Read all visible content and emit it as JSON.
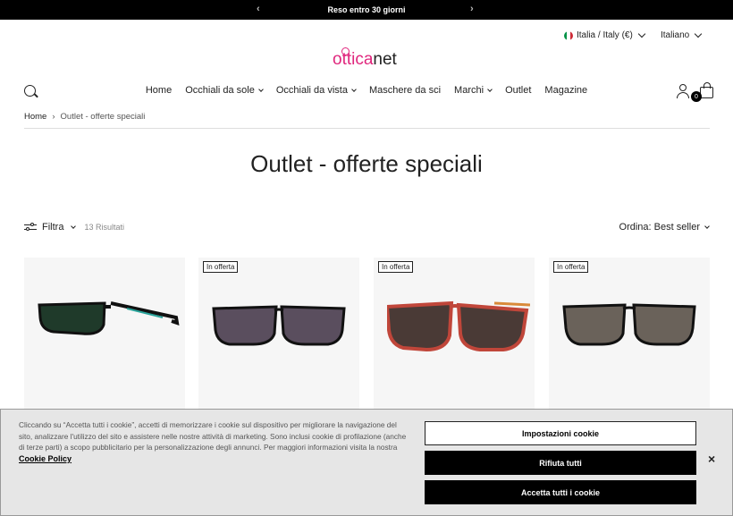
{
  "announcement": {
    "text": "Reso entro 30 giorni",
    "prev_icon": "chevron-left-icon",
    "next_icon": "chevron-right-icon"
  },
  "header": {
    "country": "Italia / Italy (€)",
    "language": "Italiano",
    "logo_part1": "ottica",
    "logo_part2": "net",
    "cart_count": "0"
  },
  "nav": {
    "items": [
      {
        "label": "Home"
      },
      {
        "label": "Occhiali da sole"
      },
      {
        "label": "Occhiali da vista"
      },
      {
        "label": "Maschere da sci"
      },
      {
        "label": "Marchi"
      },
      {
        "label": "Outlet"
      },
      {
        "label": "Magazine"
      }
    ]
  },
  "breadcrumb": {
    "home": "Home",
    "separator": "›",
    "current": "Outlet - offerte speciali"
  },
  "page": {
    "title": "Outlet - offerte speciali"
  },
  "toolbar": {
    "filter_label": "Filtra",
    "results": "13 Risultati",
    "sort_label": "Ordina: Best seller"
  },
  "products": [
    {
      "tag": ""
    },
    {
      "tag": "In offerta"
    },
    {
      "tag": "In offerta"
    },
    {
      "tag": "In offerta"
    }
  ],
  "cookie": {
    "text": "Cliccando su “Accetta tutti i cookie”, accetti di memorizzare i cookie sul dispositivo per migliorare la navigazione del sito, analizzare l'utilizzo del sito e assistere nelle nostre attività di marketing. Sono inclusi cookie di profilazione (anche di terze parti) a scopo pubblicitario per la personalizzazione degli annunci. Per maggiori informazioni visita la nostra",
    "policy_link": "Cookie Policy",
    "settings_button": "Impostazioni cookie",
    "reject_button": "Rifiuta tutti",
    "accept_button": "Accetta tutti i cookie",
    "close": "×"
  },
  "colors": {
    "brand_pink": "#e0267d",
    "topbar": "#000000"
  }
}
